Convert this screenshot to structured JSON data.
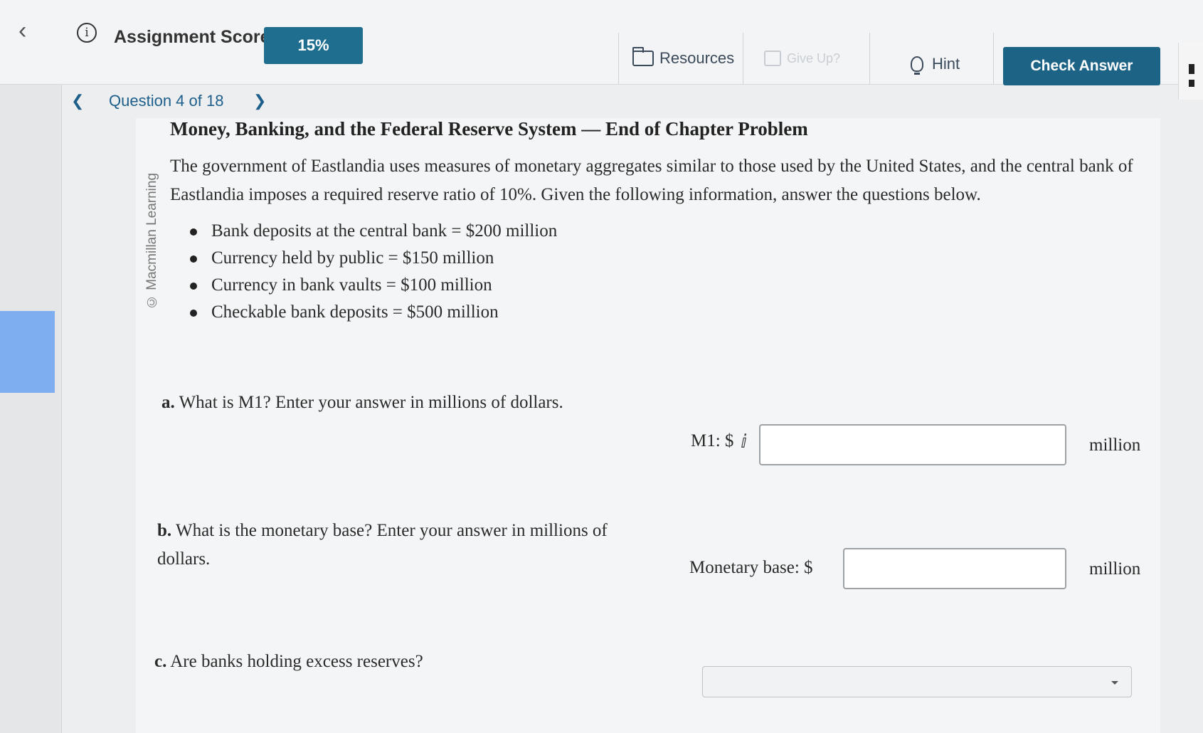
{
  "header": {
    "assignment_score_label": "Assignment Score:",
    "assignment_score_value": "15%",
    "resources_label": "Resources",
    "give_up_label": "Give Up?",
    "hint_label": "Hint",
    "check_answer_label": "Check Answer"
  },
  "question_nav": {
    "label": "Question 4 of 18"
  },
  "problem": {
    "title": "Money, Banking, and the Federal Reserve System — End of Chapter Problem",
    "credit": "© Macmillan Learning",
    "intro": "The government of Eastlandia uses measures of monetary aggregates similar to those used by the United States, and the central bank of Eastlandia imposes a required reserve ratio of 10%. Given the following information, answer the questions below.",
    "facts": [
      "Bank deposits at the central bank = $200 million",
      "Currency held by public = $150 million",
      "Currency in bank vaults = $100 million",
      "Checkable bank deposits = $500 million"
    ]
  },
  "questions": {
    "a": {
      "letter": "a.",
      "text": "What is M1? Enter your answer in millions of dollars.",
      "field_label": "M1: $",
      "value": "",
      "unit": "million"
    },
    "b": {
      "letter": "b.",
      "text": "What is the monetary base? Enter your answer in millions of dollars.",
      "field_label": "Monetary base: $",
      "value": "",
      "unit": "million"
    },
    "c": {
      "letter": "c.",
      "text": "Are banks holding excess reserves?",
      "selected": ""
    }
  },
  "colors": {
    "primary_button": "#1d6386",
    "score_pill": "#1f6e90",
    "link": "#1d5f8a",
    "sidebar_highlight": "#7eaef0"
  },
  "icons": [
    "info-icon",
    "folder-icon",
    "give-up-icon",
    "lightbulb-icon",
    "chevron-left-icon",
    "chevron-right-icon",
    "text-cursor-icon",
    "caret-down-icon"
  ]
}
